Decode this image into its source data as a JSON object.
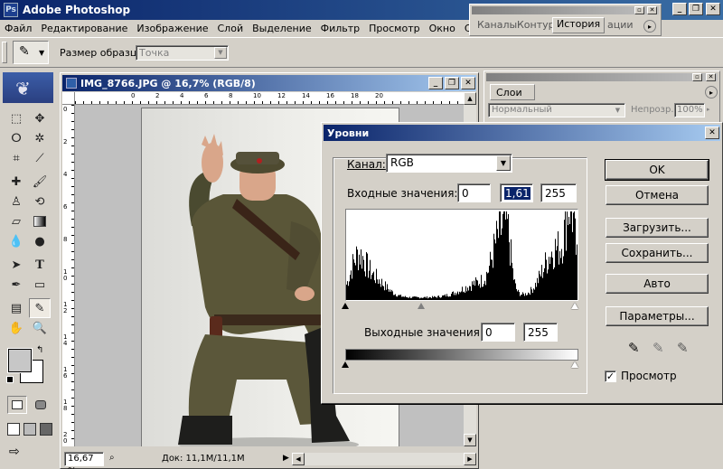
{
  "app": {
    "title": "Adobe Photoshop"
  },
  "menu": [
    "Файл",
    "Редактирование",
    "Изображение",
    "Слой",
    "Выделение",
    "Фильтр",
    "Просмотр",
    "Окно",
    "Справка"
  ],
  "options_bar": {
    "sample_size_label": "Размер образца:",
    "sample_size_value": "Точка"
  },
  "history_panel": {
    "tabs": [
      "Каналы",
      "Контур",
      "История",
      "ации"
    ],
    "active_tab": "История"
  },
  "layers_panel": {
    "tab": "Слои",
    "blend_mode": "Нормальный",
    "opacity_label": "Непрозр.:",
    "opacity_value": "100%"
  },
  "document": {
    "title": "IMG_8766.JPG @ 16,7% (RGB/8)",
    "zoom": "16,67 %",
    "doc_info": "Док: 11,1M/11,1M",
    "ruler_top": [
      "0",
      "2",
      "4",
      "6",
      "8",
      "10",
      "12",
      "14",
      "16",
      "18",
      "20"
    ],
    "ruler_left": [
      "0",
      "2",
      "4",
      "6",
      "8",
      "1 0",
      "1 2",
      "1 4",
      "1 6",
      "1 8",
      "2 0"
    ]
  },
  "levels_dialog": {
    "title": "Уровни",
    "channel_label": "Канал:",
    "channel_value": "RGB",
    "input_label": "Входные значения:",
    "input_black": "0",
    "input_gamma": "1,61",
    "input_white": "255",
    "output_label": "Выходные значения:",
    "output_black": "0",
    "output_white": "255",
    "buttons": {
      "ok": "OK",
      "cancel": "Отмена",
      "load": "Загрузить...",
      "save": "Сохранить...",
      "auto": "Авто",
      "options": "Параметры..."
    },
    "preview_label": "Просмотр",
    "preview_checked": true
  }
}
